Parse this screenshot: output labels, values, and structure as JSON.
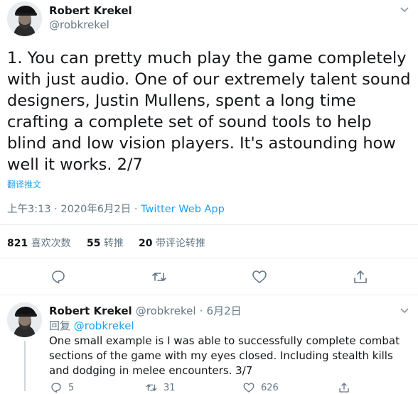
{
  "tweet": {
    "author_name": "Robert Krekel",
    "author_handle": "@robkrekel",
    "text": "1. You can pretty much play the game completely with just audio. One of our extremely talent sound designers, Justin Mullens, spent a long time crafting a complete set of sound tools to help blind and low vision players. It's astounding how well it works. 2/7",
    "translate_label": "翻译推文",
    "timestamp": "上午3:13 · 2020年6月2日 · ",
    "source": "Twitter Web App",
    "stats": {
      "likes_count": "821",
      "likes_label": "喜欢次数",
      "retweets_count": "55",
      "retweets_label": "转推",
      "quotes_count": "20",
      "quotes_label": "带评论转推"
    }
  },
  "reply": {
    "author_name": "Robert Krekel",
    "author_handle": "@robkrekel",
    "separator": "·",
    "date": "6月2日",
    "reply_prefix": "回复",
    "reply_to": "@robkrekel",
    "text": "One small example is I was able to successfully complete combat sections of the game with my eyes closed. Including stealth kills and dodging in melee encounters. 3/7",
    "reply_count": "5",
    "retweet_count": "31",
    "like_count": "626"
  },
  "colors": {
    "accent": "#1da1f2",
    "muted": "#657786",
    "text": "#14171a",
    "divider": "#e6ecf0"
  }
}
